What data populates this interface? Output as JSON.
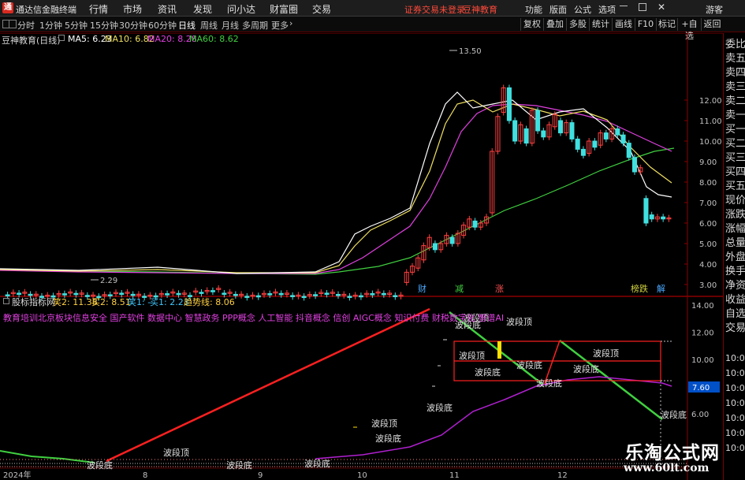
{
  "title_bar": {
    "app_name": "通达信金融终端",
    "menu": [
      "行情",
      "市场",
      "资讯",
      "发现",
      "问小达",
      "财富圈",
      "交易"
    ],
    "status_text": "证券交易未登录",
    "stock_name": "豆神教育",
    "right_menu": [
      "功能",
      "版面",
      "公式",
      "选项"
    ],
    "guest": "游客"
  },
  "toolbar": {
    "periods": [
      "分时",
      "1分钟",
      "5分钟",
      "15分钟",
      "30分钟",
      "60分钟",
      "日线",
      "周线",
      "月线",
      "多周期",
      "更多"
    ],
    "active_period": "日线",
    "right_buttons": [
      "复权",
      "叠加",
      "多股",
      "统计",
      "画线",
      "F10",
      "标记",
      "+自选",
      "返回"
    ]
  },
  "main_chart": {
    "title": "豆神教育(日线)",
    "ma": [
      {
        "label": "MA5: 6.23",
        "color": "#ffffff"
      },
      {
        "label": "MA10: 6.82",
        "color": "#f0e060"
      },
      {
        "label": "MA20: 8.28",
        "color": "#e040e0"
      },
      {
        "label": "MA60: 8.62",
        "color": "#40d040"
      }
    ],
    "y_ticks": [
      "12.00",
      "11.00",
      "10.00",
      "9.00",
      "8.00",
      "7.00",
      "6.00",
      "5.00",
      "4.00",
      "3.00"
    ],
    "high_label": "13.50",
    "low_label": "2.29",
    "event_markers": [
      {
        "text": "财",
        "color": "#4aa8ff"
      },
      {
        "text": "减",
        "color": "#40d040"
      },
      {
        "text": "涨",
        "color": "#ff5050"
      },
      {
        "text": "榜跌",
        "color": "#d0d040"
      },
      {
        "text": "解",
        "color": "#4aa8ff"
      }
    ]
  },
  "indicator_panel": {
    "name": "股标指标网",
    "values": [
      {
        "label": "笑2: 11.38",
        "color": "#ffd040"
      },
      {
        "label": "买2: 8.51",
        "color": "#ffd040"
      },
      {
        "label": "笑1: -",
        "color": "#40c8ff"
      },
      {
        "label": "买1: 2.23",
        "color": "#40c8ff"
      },
      {
        "label": "趋势线: 8.06",
        "color": "#ffd040"
      }
    ],
    "concepts": "教育培训北京板块信息安全 国产软件 数据中心 智慧政务 PPP概念 人工智能 抖音概念 信创 AIGC概念 知识付费 财税数字化 智谱AI",
    "y_ticks": [
      "14.00",
      "12.00",
      "10.00",
      "8.00",
      "6.00"
    ],
    "current_value": "7.60",
    "wave_top": "波段顶",
    "wave_bottom": "波段底",
    "date_labels": [
      "2024年",
      "8",
      "9",
      "10",
      "11",
      "12"
    ]
  },
  "right_panel": {
    "items": [
      "委比",
      "卖五",
      "卖四",
      "卖三",
      "卖二",
      "卖一",
      "买一",
      "买二",
      "买三",
      "买四",
      "买五",
      "现价",
      "涨跌",
      "涨幅",
      "总量",
      "外盘",
      "换手",
      "净资",
      "收益",
      "自选",
      "交易"
    ],
    "times": [
      "10:00",
      "10:00",
      "10:00",
      "10:00",
      "10:00",
      "10:00",
      "10:00"
    ]
  },
  "watermark": {
    "title": "乐淘公式网",
    "url": "www.60lt.com"
  },
  "colors": {
    "up": "#ff4040",
    "down": "#40e0e0",
    "separator": "#8a0000"
  }
}
